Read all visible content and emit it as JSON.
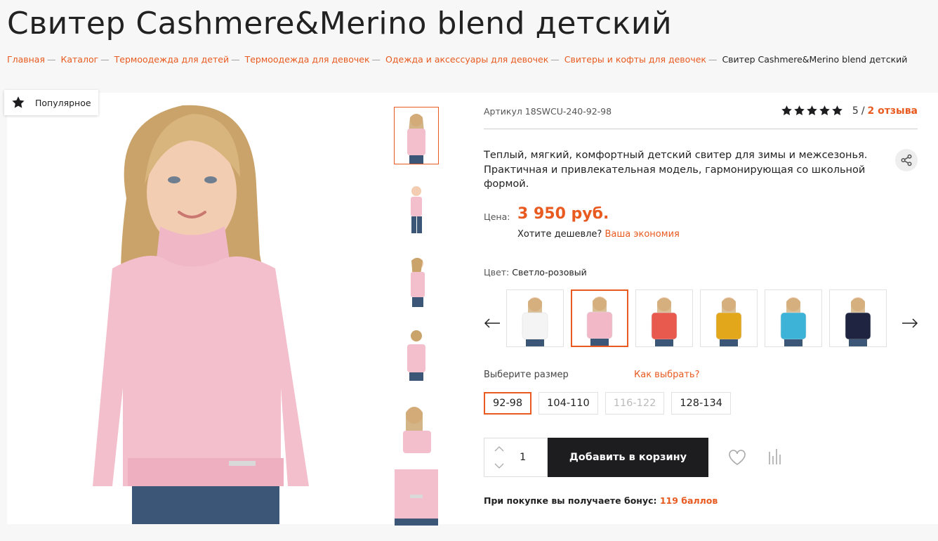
{
  "page": {
    "title": "Свитер Cashmere&Merino blend детский"
  },
  "breadcrumb": {
    "separator": "—",
    "items": [
      "Главная",
      "Каталог",
      "Термоодежда для детей",
      "Термоодежда для девочек",
      "Одежда и аксессуары для девочек",
      "Свитеры и кофты для девочек"
    ],
    "current": "Свитер Cashmere&Merino blend детский"
  },
  "badge": {
    "label": "Популярное",
    "icon": "star-icon"
  },
  "product": {
    "sku": "Артикул 18SWCU-240-92-98",
    "rating": {
      "score": 5,
      "stars": 5,
      "display": "5",
      "separator": "/",
      "reviews": "2 отзыва"
    },
    "description": "Теплый, мягкий, комфортный детский свитер для зимы и межсезонья. Практичная и привлекательная модель, гармонирующая со школьной формой.",
    "price_label": "Цена:",
    "price": "3 950 руб.",
    "cheaper_text": "Хотите дешевле?",
    "cheaper_link": "Ваша экономия",
    "color_label": "Цвет:",
    "color_value": "Светло-розовый",
    "size_label": "Выберите размер",
    "size_help": "Как выбрать?",
    "sizes": [
      "92-98",
      "104-110",
      "116-122",
      "128-134"
    ],
    "selected_size": "92-98",
    "quantity": "1",
    "add_to_cart": "Добавить в корзину",
    "bonus_text": "При покупке вы получаете бонус:",
    "bonus_points": "119 баллов"
  },
  "colors": {
    "accent": "#e85a1f",
    "cart_button": "#1d1d1f",
    "swatches": [
      "#f4f4f4",
      "#f2b8c8",
      "#e8594e",
      "#e3a71c",
      "#3db3d8",
      "#1f2540"
    ]
  },
  "selected_swatch_index": 1
}
